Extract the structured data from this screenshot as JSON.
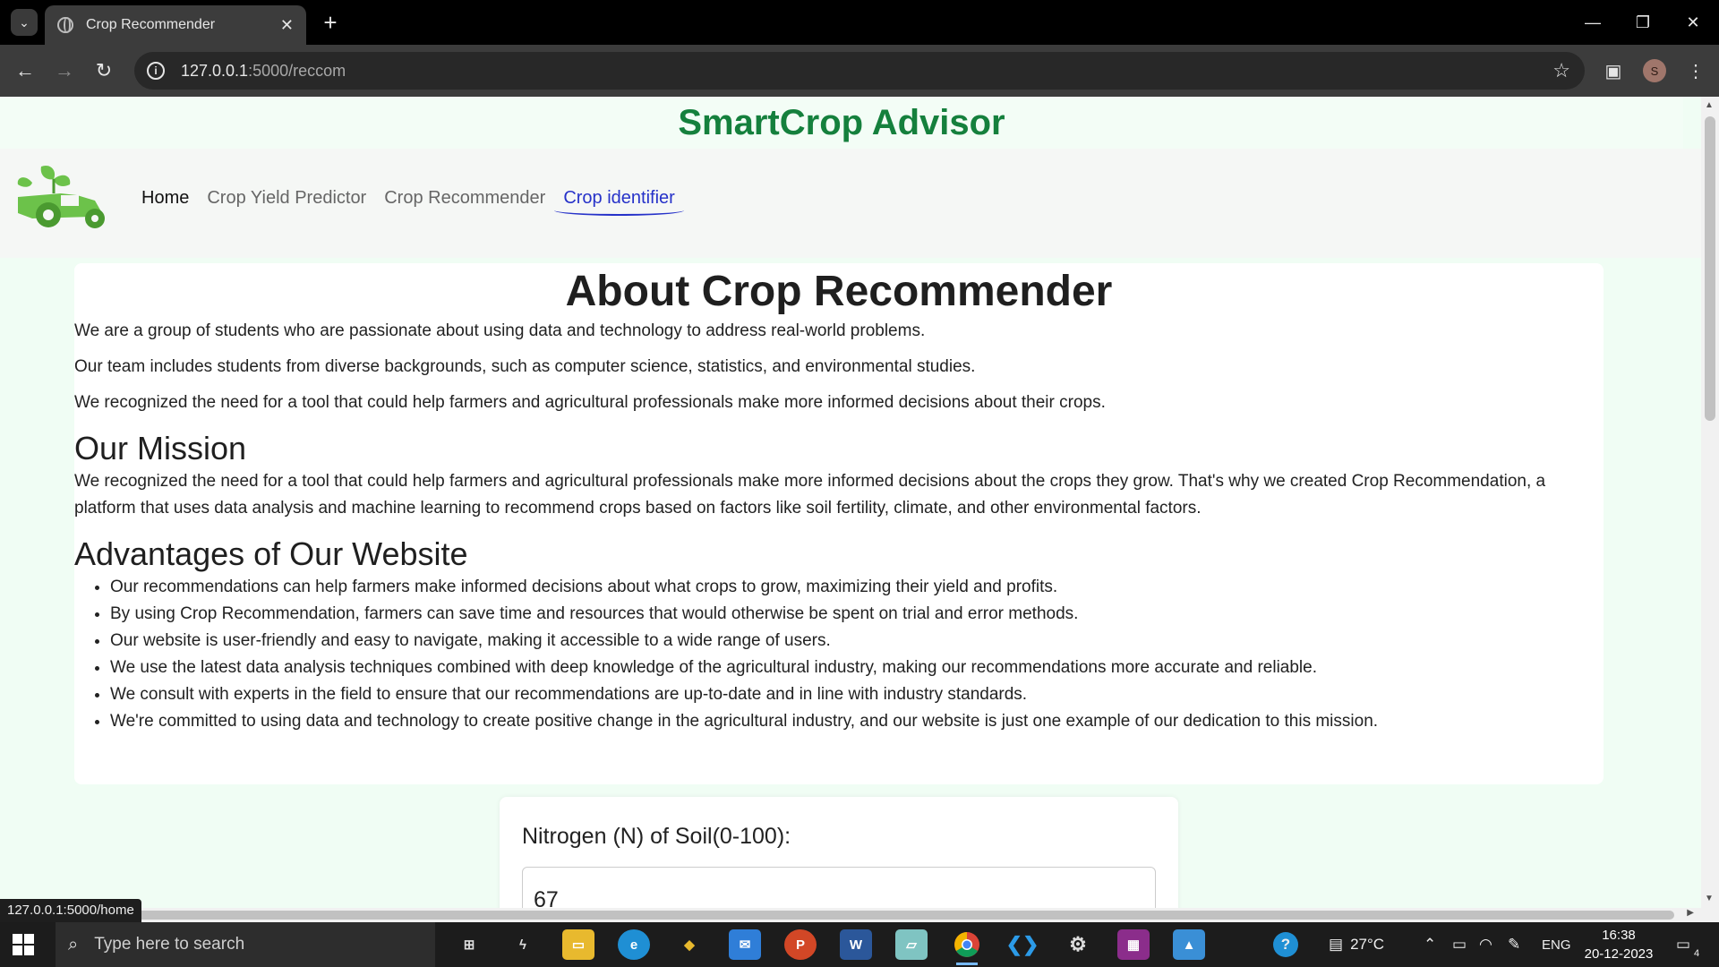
{
  "browser": {
    "tab_title": "Crop Recommender",
    "tab_close": "✕",
    "new_tab": "+",
    "url_host": "127.0.0.1",
    "url_rest": ":5000/reccom",
    "profile_initial": "S",
    "status_url": "127.0.0.1:5000/home"
  },
  "site": {
    "title": "SmartCrop Advisor",
    "nav": [
      "Home",
      "Crop Yield Predictor",
      "Crop Recommender",
      "Crop identifier"
    ]
  },
  "about": {
    "heading": "About Crop Recommender",
    "paragraphs": [
      "We are a group of students who are passionate about using data and technology to address real-world problems.",
      "Our team includes students from diverse backgrounds, such as computer science, statistics, and environmental studies.",
      "We recognized the need for a tool that could help farmers and agricultural professionals make more informed decisions about their crops."
    ],
    "mission_heading": "Our Mission",
    "mission_text": "We recognized the need for a tool that could help farmers and agricultural professionals make more informed decisions about the crops they grow. That's why we created Crop Recommendation, a platform that uses data analysis and machine learning to recommend crops based on factors like soil fertility, climate, and other environmental factors.",
    "advantages_heading": "Advantages of Our Website",
    "advantages": [
      "Our recommendations can help farmers make informed decisions about what crops to grow, maximizing their yield and profits.",
      "By using Crop Recommendation, farmers can save time and resources that would otherwise be spent on trial and error methods.",
      "Our website is user-friendly and easy to navigate, making it accessible to a wide range of users.",
      "We use the latest data analysis techniques combined with deep knowledge of the agricultural industry, making our recommendations more accurate and reliable.",
      "We consult with experts in the field to ensure that our recommendations are up-to-date and in line with industry standards.",
      "We're committed to using data and technology to create positive change in the agricultural industry, and our website is just one example of our dedication to this mission."
    ]
  },
  "form": {
    "nitrogen_label": "Nitrogen (N) of Soil(0-100):",
    "nitrogen_value": "67"
  },
  "taskbar": {
    "search_placeholder": "Type here to search",
    "weather": "27°C",
    "language": "ENG",
    "time": "16:38",
    "date": "20-12-2023",
    "notifications": "4"
  },
  "colors": {
    "brand_green": "#15803d",
    "active_link": "#2632c9",
    "page_bg": "#f0fdf4"
  }
}
